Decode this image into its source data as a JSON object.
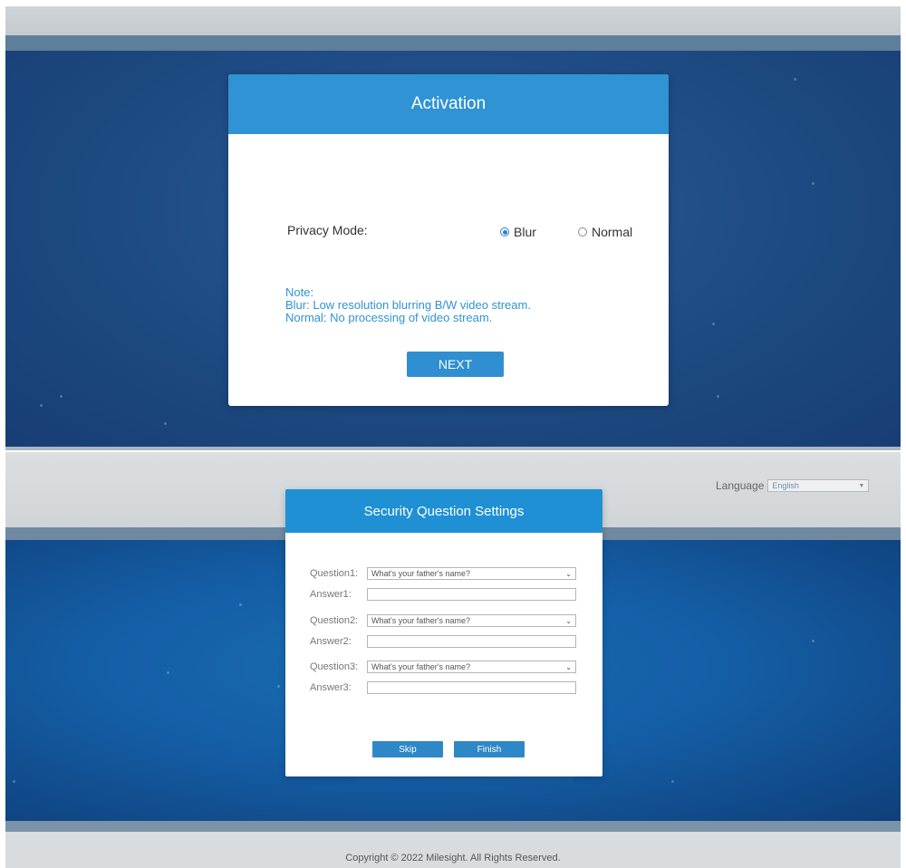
{
  "activation": {
    "title": "Activation",
    "privacy_label": "Privacy Mode:",
    "options": [
      {
        "label": "Blur",
        "selected": true
      },
      {
        "label": "Normal",
        "selected": false
      }
    ],
    "note": {
      "heading": "Note:",
      "line1": "Blur:  Low resolution blurring B/W video stream.",
      "line2": "Normal: No processing of video stream."
    },
    "next_label": "NEXT"
  },
  "security": {
    "language_label": "Language",
    "language_value": "English",
    "title": "Security Question Settings",
    "rows": [
      {
        "q_label": "Question1:",
        "q_value": "What's your father's name?",
        "a_label": "Answer1:",
        "a_value": ""
      },
      {
        "q_label": "Question2:",
        "q_value": "What's your father's name?",
        "a_label": "Answer2:",
        "a_value": ""
      },
      {
        "q_label": "Question3:",
        "q_value": "What's your father's name?",
        "a_label": "Answer3:",
        "a_value": ""
      }
    ],
    "skip_label": "Skip",
    "finish_label": "Finish",
    "copyright": "Copyright © 2022 Milesight. All Rights Reserved."
  },
  "colors": {
    "header_blue": "#2f93d4",
    "background_blue": "#1d4a82",
    "note_text": "#2f93d4",
    "button_blue": "#2e88c8"
  }
}
